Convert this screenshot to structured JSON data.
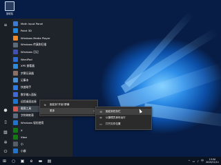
{
  "desktop": {
    "recycle_bin_label": "回收站"
  },
  "start_menu": {
    "apps": [
      {
        "label": "Math Input Panel",
        "color": "#3a7bd5"
      },
      {
        "label": "Paint 3D",
        "color": "#1e88e5"
      },
      {
        "label": "Windows Media Player",
        "color": "#f08a24"
      },
      {
        "label": "Windows 传真和扫描",
        "color": "#5a6b7a"
      },
      {
        "label": "Windows 日记",
        "color": "#3f51b5"
      },
      {
        "label": "WordPad",
        "color": "#2b6cd6"
      },
      {
        "label": "XPS 查看器",
        "color": "#2d8bd9"
      },
      {
        "label": "步骤记录器",
        "color": "#8d6e63"
      },
      {
        "label": "记事本",
        "color": "#4a90d9"
      },
      {
        "label": "快速助手",
        "color": "#2c7be5"
      },
      {
        "label": "数学输入面板",
        "color": "#3f6ad8"
      },
      {
        "label": "远程桌面连接",
        "color": "#1976d2"
      },
      {
        "label": "截图工具",
        "color": "#d9534f"
      },
      {
        "label": "字符映射表",
        "color": "#5b6b7b"
      },
      {
        "label": "Windows 轻松使用",
        "color": "#1e74d0"
      },
      {
        "label": "X",
        "color": "#107c10"
      },
      {
        "label": "Xbox",
        "color": "#107c10"
      },
      {
        "label": "小",
        "color": "#555e66"
      },
      {
        "label": "小娜",
        "color": "#1e74d0"
      }
    ],
    "rail_icons": [
      "hamburger-icon",
      "user-icon",
      "document-icon",
      "pictures-icon",
      "settings-icon",
      "power-icon"
    ]
  },
  "context_menu": {
    "items": [
      {
        "label": "固定到\"开始\"屏幕",
        "icon": "⊕"
      },
      {
        "label": "更多",
        "icon": "",
        "submenu_arrow": "›"
      }
    ]
  },
  "submenu": {
    "items": [
      {
        "label": "固定到任务栏",
        "icon": "⊞"
      },
      {
        "label": "以管理员身份运行",
        "icon": "⛨"
      },
      {
        "label": "打开文件位置",
        "icon": "▭"
      }
    ]
  },
  "taskbar": {
    "start_glyph": "⊞",
    "apps": [
      {
        "name": "search-icon",
        "glyph": "○"
      },
      {
        "name": "task-view-icon",
        "glyph": "▣"
      },
      {
        "name": "edge-icon",
        "glyph": "e"
      },
      {
        "name": "explorer-icon",
        "glyph": "▬"
      },
      {
        "name": "store-icon",
        "glyph": "▤"
      }
    ],
    "tray_glyphs": [
      "^",
      "▭",
      "♪",
      "中"
    ],
    "time": "13:50",
    "date": "2019/11/11"
  }
}
